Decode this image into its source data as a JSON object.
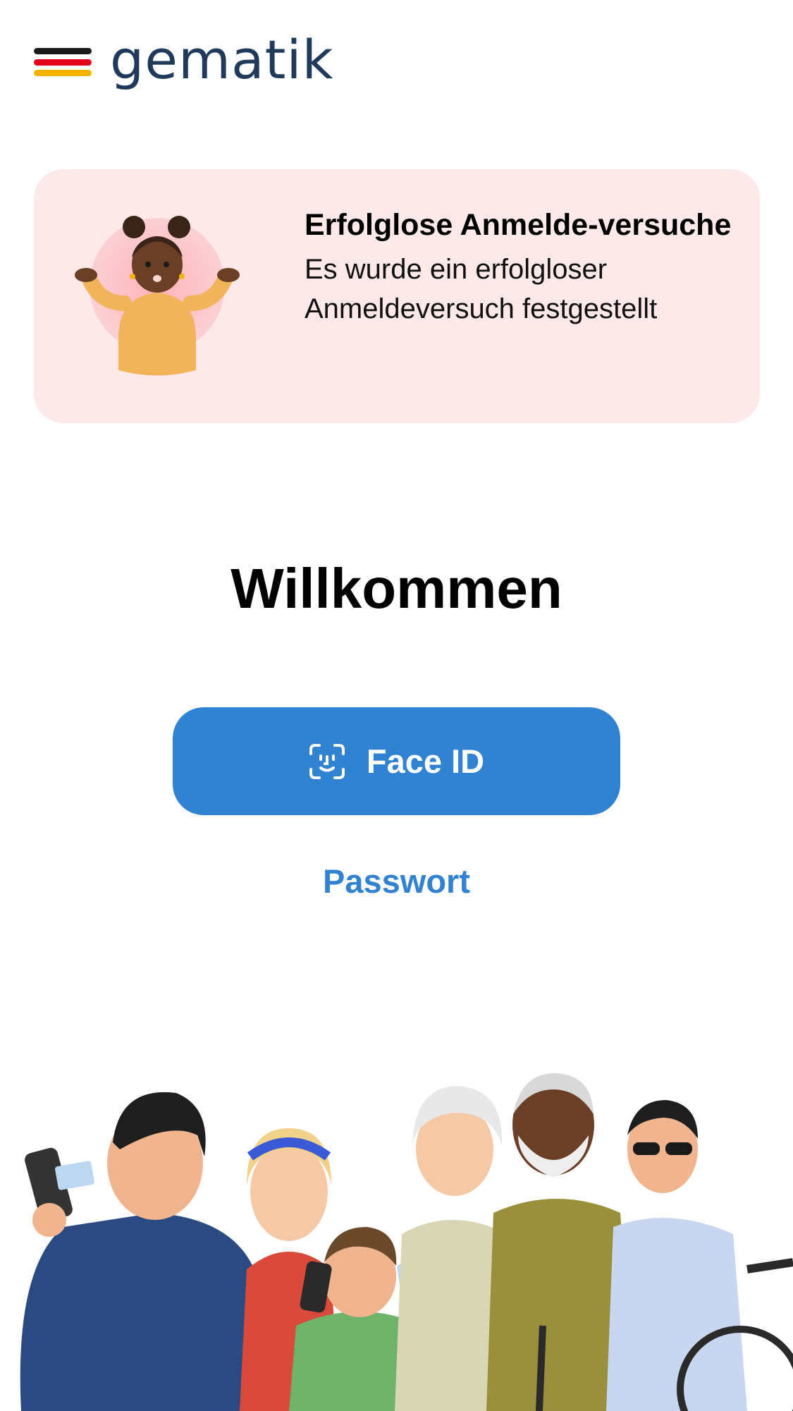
{
  "header": {
    "logo_text": "gematik",
    "logo_colors": [
      "#1a1a1a",
      "#e2001a",
      "#f4b400"
    ]
  },
  "alert": {
    "title": "Erfolglose Anmelde-versuche",
    "body": "Es wurde ein erfolgloser Anmeldeversuch festgestellt",
    "background": "#fde8ea",
    "illustration": "shrugging-person-illustration"
  },
  "main": {
    "welcome": "Willkommen",
    "faceid_label": "Face ID",
    "faceid_icon": "face-id-icon",
    "password_label": "Passwort",
    "accent_color": "#3282d2"
  },
  "footer": {
    "illustration": "group-of-people-illustration"
  }
}
